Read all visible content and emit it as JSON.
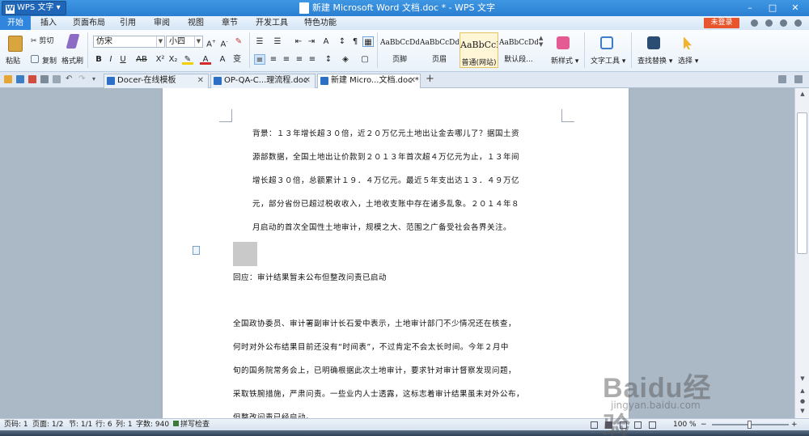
{
  "app": {
    "brand_label": "WPS 文字",
    "window_title": "新建 Microsoft Word 文档.doc * - WPS 文字"
  },
  "menu": {
    "tabs": [
      "开始",
      "插入",
      "页面布局",
      "引用",
      "审阅",
      "视图",
      "章节",
      "开发工具",
      "特色功能"
    ],
    "active_tab": "开始",
    "login_label": "未登录"
  },
  "ribbon": {
    "paste": "粘贴",
    "cut": "剪切",
    "copy": "复制",
    "format_painter": "格式刷",
    "font_name": "仿宋",
    "font_size": "小四",
    "styles": [
      {
        "sample": "AaBbCcDd",
        "name": "页脚"
      },
      {
        "sample": "AaBbCcDd",
        "name": "页眉"
      },
      {
        "sample": "AaBbCcI",
        "name": "普通(网站)"
      },
      {
        "sample": "AaBbCcDd",
        "name": "默认段..."
      }
    ],
    "new_style": "新样式",
    "text_tools": "文字工具",
    "find_replace": "查找替换",
    "select": "选择"
  },
  "doc_tabs": [
    {
      "label": "Docer-在线模板",
      "active": false
    },
    {
      "label": "OP-QA-C...理流程.doc",
      "active": false
    },
    {
      "label": "新建 Micro...文档.doc *",
      "active": true
    }
  ],
  "document": {
    "paragraph1": [
      "背景：１３年增长超３０倍，近２０万亿元土地出让金去哪儿了？据国土资",
      "源部数据，全国土地出让价款到２０１３年首次超４万亿元为止，１３年间",
      "增长超３０倍，总额累计１９．４万亿元。最近５年支出达１３．４９万亿",
      "元，部分省份已超过税收收入，土地收支账中存在诸多乱象。２０１４年８",
      "月启动的首次全国性土地审计，规模之大、范围之广备受社会各界关注。"
    ],
    "response_line": "回应：审计结果暂未公布但整改问责已启动",
    "paragraph2": [
      "全国政协委员、审计署副审计长石爱中表示，土地审计部门不少情况还在核查，",
      "何时对外公布结果目前还没有“时间表”，不过肯定不会太长时间。今年２月中",
      "旬的国务院常务会上，已明确根据此次土地审计，要求针对审计督察发现问题，",
      "采取铁腕措施，严肃问责。一些业内人士透露，这标志着审计结果虽未对外公布，",
      "但整改问责已经启动。"
    ]
  },
  "status": {
    "page": "页码: 1",
    "pages": "页面: 1/2",
    "section": "节: 1/1",
    "row": "行: 6",
    "col": "列: 1",
    "words": "字数: 940",
    "spell": "拼写检查",
    "zoom": "100 %"
  },
  "watermark": {
    "brand": "Baidu经验",
    "url": "jingyan.baidu.com"
  }
}
